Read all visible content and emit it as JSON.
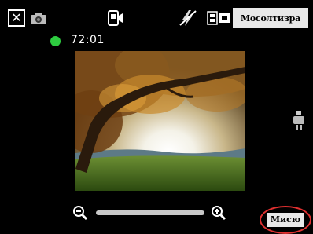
{
  "top_bar": {
    "close_symbol": "✕",
    "title_badge": "Мосолтизра",
    "icons": [
      "close-icon",
      "camera-mode-icon",
      "video-mode-icon",
      "flash-icon",
      "resolution-icon"
    ]
  },
  "status": {
    "timer": "72:01",
    "indicator_color": "#2ecc40"
  },
  "zoom": {
    "out_icon": "zoom-out-icon",
    "in_icon": "zoom-in-icon"
  },
  "bottom": {
    "menu_label": "Мисю",
    "highlight_color": "#e03030"
  }
}
